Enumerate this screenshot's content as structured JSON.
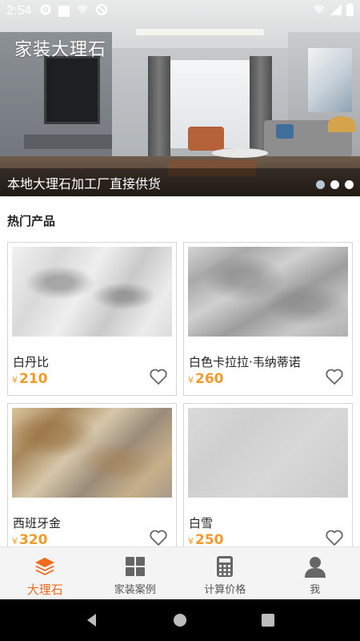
{
  "status_bar": {
    "time": "2:54",
    "icons": [
      "settings-icon",
      "square-icon",
      "wifi-icon",
      "sync-icon",
      "signal-icon",
      "battery-icon"
    ]
  },
  "banner": {
    "title": "家装大理石",
    "caption": "本地大理石加工厂直接供货",
    "slide_count": 3,
    "active_slide": 0
  },
  "section": {
    "title": "热门产品"
  },
  "products": [
    {
      "name": "白丹比",
      "currency": "¥",
      "price": "210",
      "favorite": false
    },
    {
      "name": "白色卡拉拉·韦纳蒂诺",
      "currency": "¥",
      "price": "260",
      "favorite": false
    },
    {
      "name": "西班牙金",
      "currency": "¥",
      "price": "320",
      "favorite": false
    },
    {
      "name": "白雪",
      "currency": "¥",
      "price": "250",
      "favorite": false
    }
  ],
  "tabs": [
    {
      "label": "大理石",
      "icon": "layers-icon",
      "active": true
    },
    {
      "label": "家装案例",
      "icon": "grid-icon",
      "active": false
    },
    {
      "label": "计算价格",
      "icon": "calculator-icon",
      "active": false
    },
    {
      "label": "我",
      "icon": "person-icon",
      "active": false
    }
  ],
  "colors": {
    "accent": "#f06a1d",
    "price": "#f39a2b",
    "tabbar_bg": "#f4f4f4",
    "icon_gray": "#666666"
  }
}
